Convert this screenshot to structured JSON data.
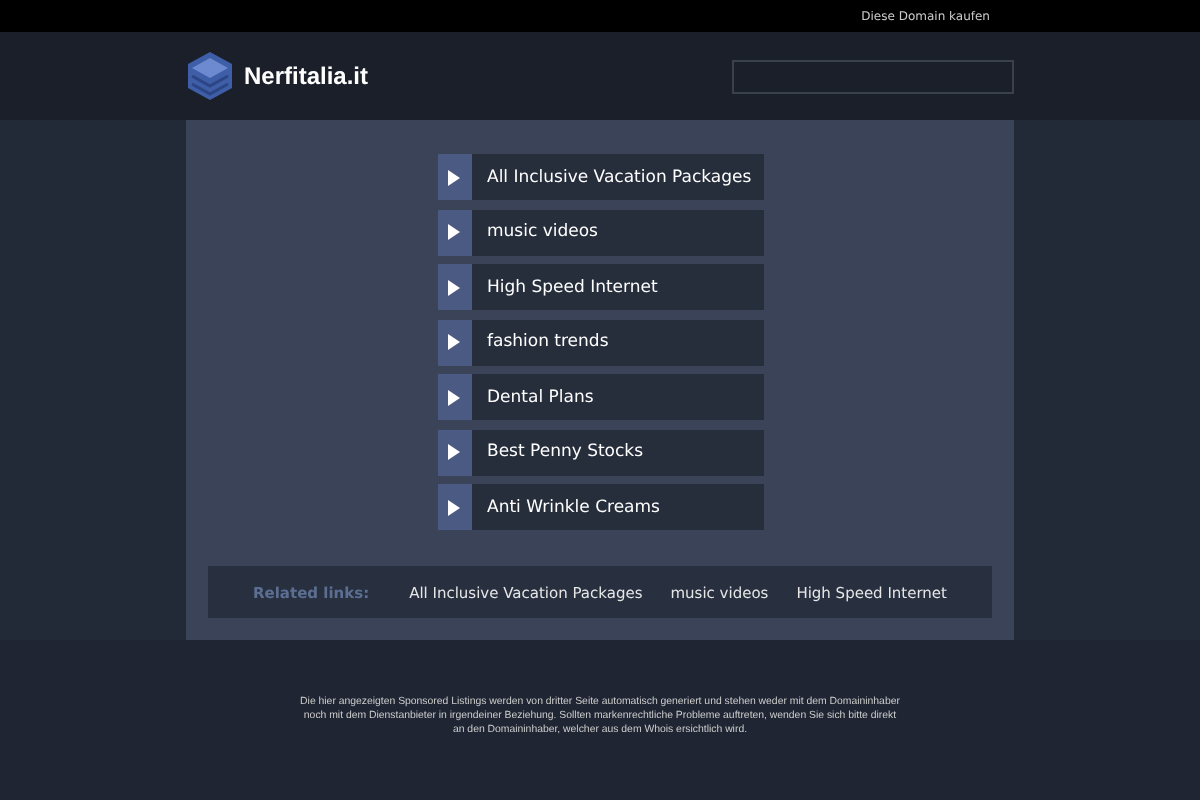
{
  "topbar": {
    "link": "Diese Domain kaufen"
  },
  "header": {
    "site_name": "Nerfitalia.it"
  },
  "links": [
    "All Inclusive Vacation Packages",
    "music videos",
    "High Speed Internet",
    "fashion trends",
    "Dental Plans",
    "Best Penny Stocks",
    "Anti Wrinkle Creams"
  ],
  "related": {
    "label": "Related links:",
    "links": [
      "All Inclusive Vacation Packages",
      "music videos",
      "High Speed Internet"
    ]
  },
  "disclaimer": "Die hier angezeigten Sponsored Listings werden von dritter Seite automatisch generiert und stehen weder mit dem Domaininhaber noch mit dem Dienstanbieter in irgendeiner Beziehung. Sollten markenrechtliche Probleme auftreten, wenden Sie sich bitte direkt an den Domaininhaber, welcher aus dem Whois ersichtlich wird."
}
